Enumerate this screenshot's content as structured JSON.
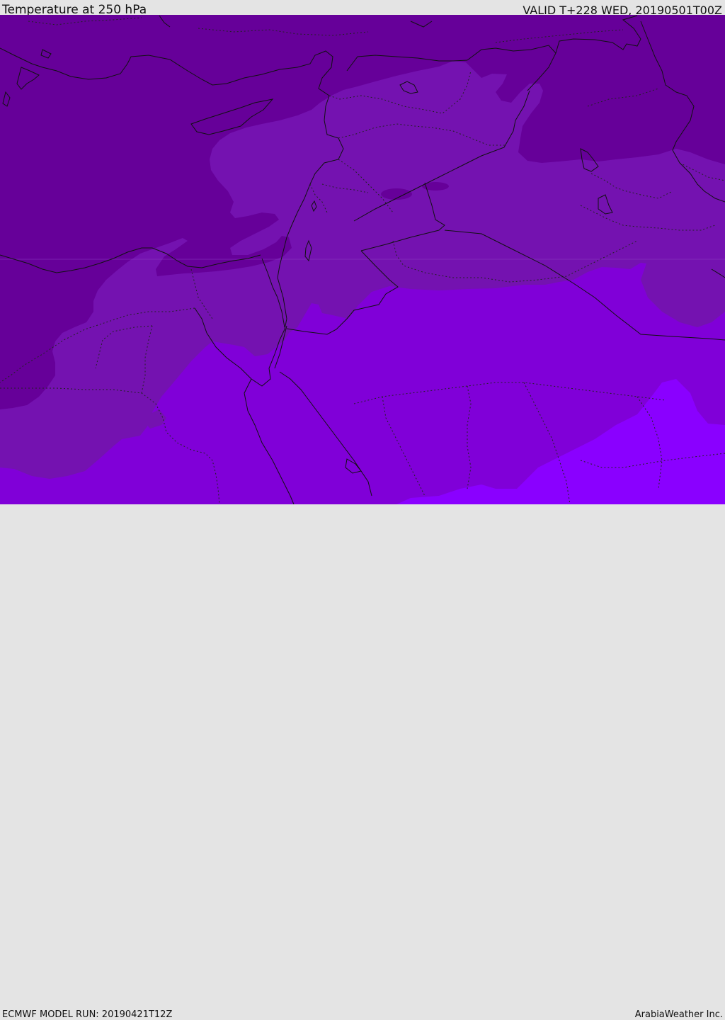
{
  "header": {
    "title": "Temperature at 250 hPa",
    "valid": "VALID T+228 WED, 20190501T00Z"
  },
  "footer": {
    "model_run": "ECMWF MODEL RUN: 20190421T12Z",
    "credit": "ArabiaWeather Inc."
  },
  "map": {
    "colors": {
      "coldest": "#660099",
      "cold": "#7412b0",
      "mid": "#8000d8",
      "warm": "#8a00ff",
      "border": "#111111"
    }
  }
}
